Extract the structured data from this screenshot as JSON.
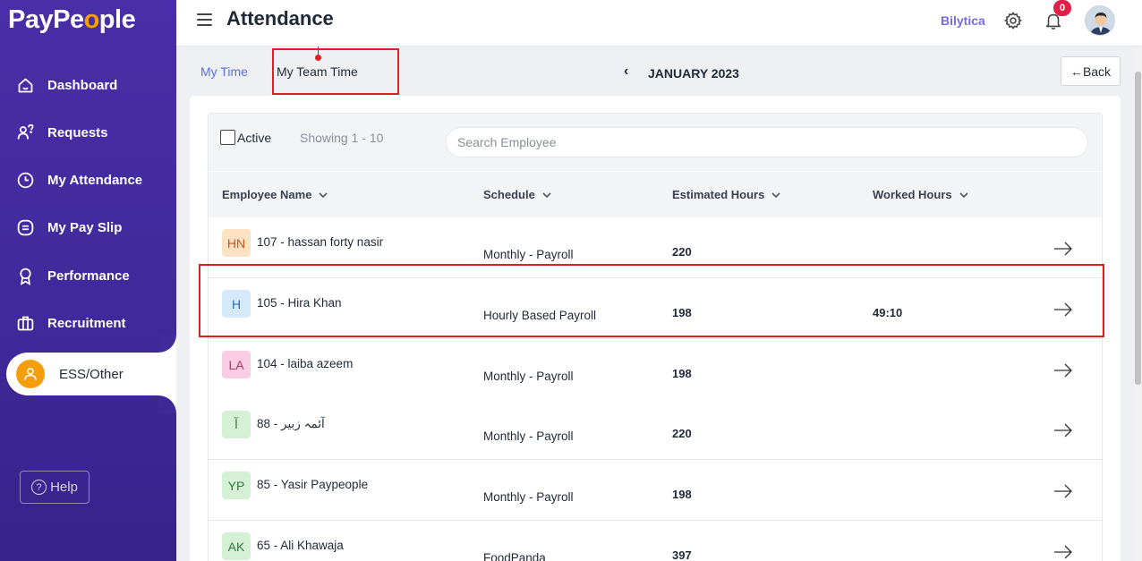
{
  "sidebar": {
    "logo_pre": "PayPe",
    "logo_o": "o",
    "logo_post": "ple",
    "items": [
      {
        "label": "Dashboard",
        "icon": "home-icon"
      },
      {
        "label": "Requests",
        "icon": "requests-icon"
      },
      {
        "label": "My Attendance",
        "icon": "clock-icon"
      },
      {
        "label": "My Pay Slip",
        "icon": "payslip-icon"
      },
      {
        "label": "Performance",
        "icon": "award-icon"
      },
      {
        "label": "Recruitment",
        "icon": "briefcase-icon"
      }
    ],
    "active_item": {
      "label": "ESS/Other",
      "icon": "user-icon"
    },
    "help": {
      "icon": "?",
      "label": "Help"
    }
  },
  "header": {
    "title": "Attendance",
    "company": "Bilytica",
    "notification_count": "0"
  },
  "subheader": {
    "tabs": [
      "My Time",
      "My Team Time"
    ],
    "prev_icon": "‹",
    "month": "JANUARY 2023",
    "back_label": "←Back"
  },
  "filters": {
    "active_label": "Active",
    "showing": "Showing 1 - 10",
    "search_placeholder": "Search Employee"
  },
  "table": {
    "columns": [
      "Employee Name",
      "Schedule",
      "Estimated Hours",
      "Worked Hours"
    ],
    "rows": [
      {
        "initials": "HN",
        "name": "107 - hassan forty nasir",
        "schedule": "Monthly - Payroll",
        "estimated": "220",
        "worked": "",
        "color": "#fde2c4",
        "text_color": "#c2571a"
      },
      {
        "initials": "H",
        "name": "105 - Hira Khan",
        "schedule": "Hourly Based Payroll",
        "estimated": "198",
        "worked": "49:10",
        "color": "#d6e9fb",
        "text_color": "#2b6cb0"
      },
      {
        "initials": "LA",
        "name": "104 - laiba azeem",
        "schedule": "Monthly - Payroll",
        "estimated": "198",
        "worked": "",
        "color": "#f9cde4",
        "text_color": "#b0306b"
      },
      {
        "initials": "آ",
        "name": "88 - آئمہ زبیر",
        "schedule": "Monthly - Payroll",
        "estimated": "220",
        "worked": "",
        "color": "#d5f0d5",
        "text_color": "#2f7a3a"
      },
      {
        "initials": "YP",
        "name": "85 - Yasir Paypeople",
        "schedule": "Monthly - Payroll",
        "estimated": "198",
        "worked": "",
        "color": "#d5f0d5",
        "text_color": "#2f7a3a"
      },
      {
        "initials": "AK",
        "name": "65 - Ali Khawaja",
        "schedule": "FoodPanda",
        "estimated": "397",
        "worked": "",
        "color": "#d5f0d5",
        "text_color": "#2f7a3a"
      }
    ]
  }
}
